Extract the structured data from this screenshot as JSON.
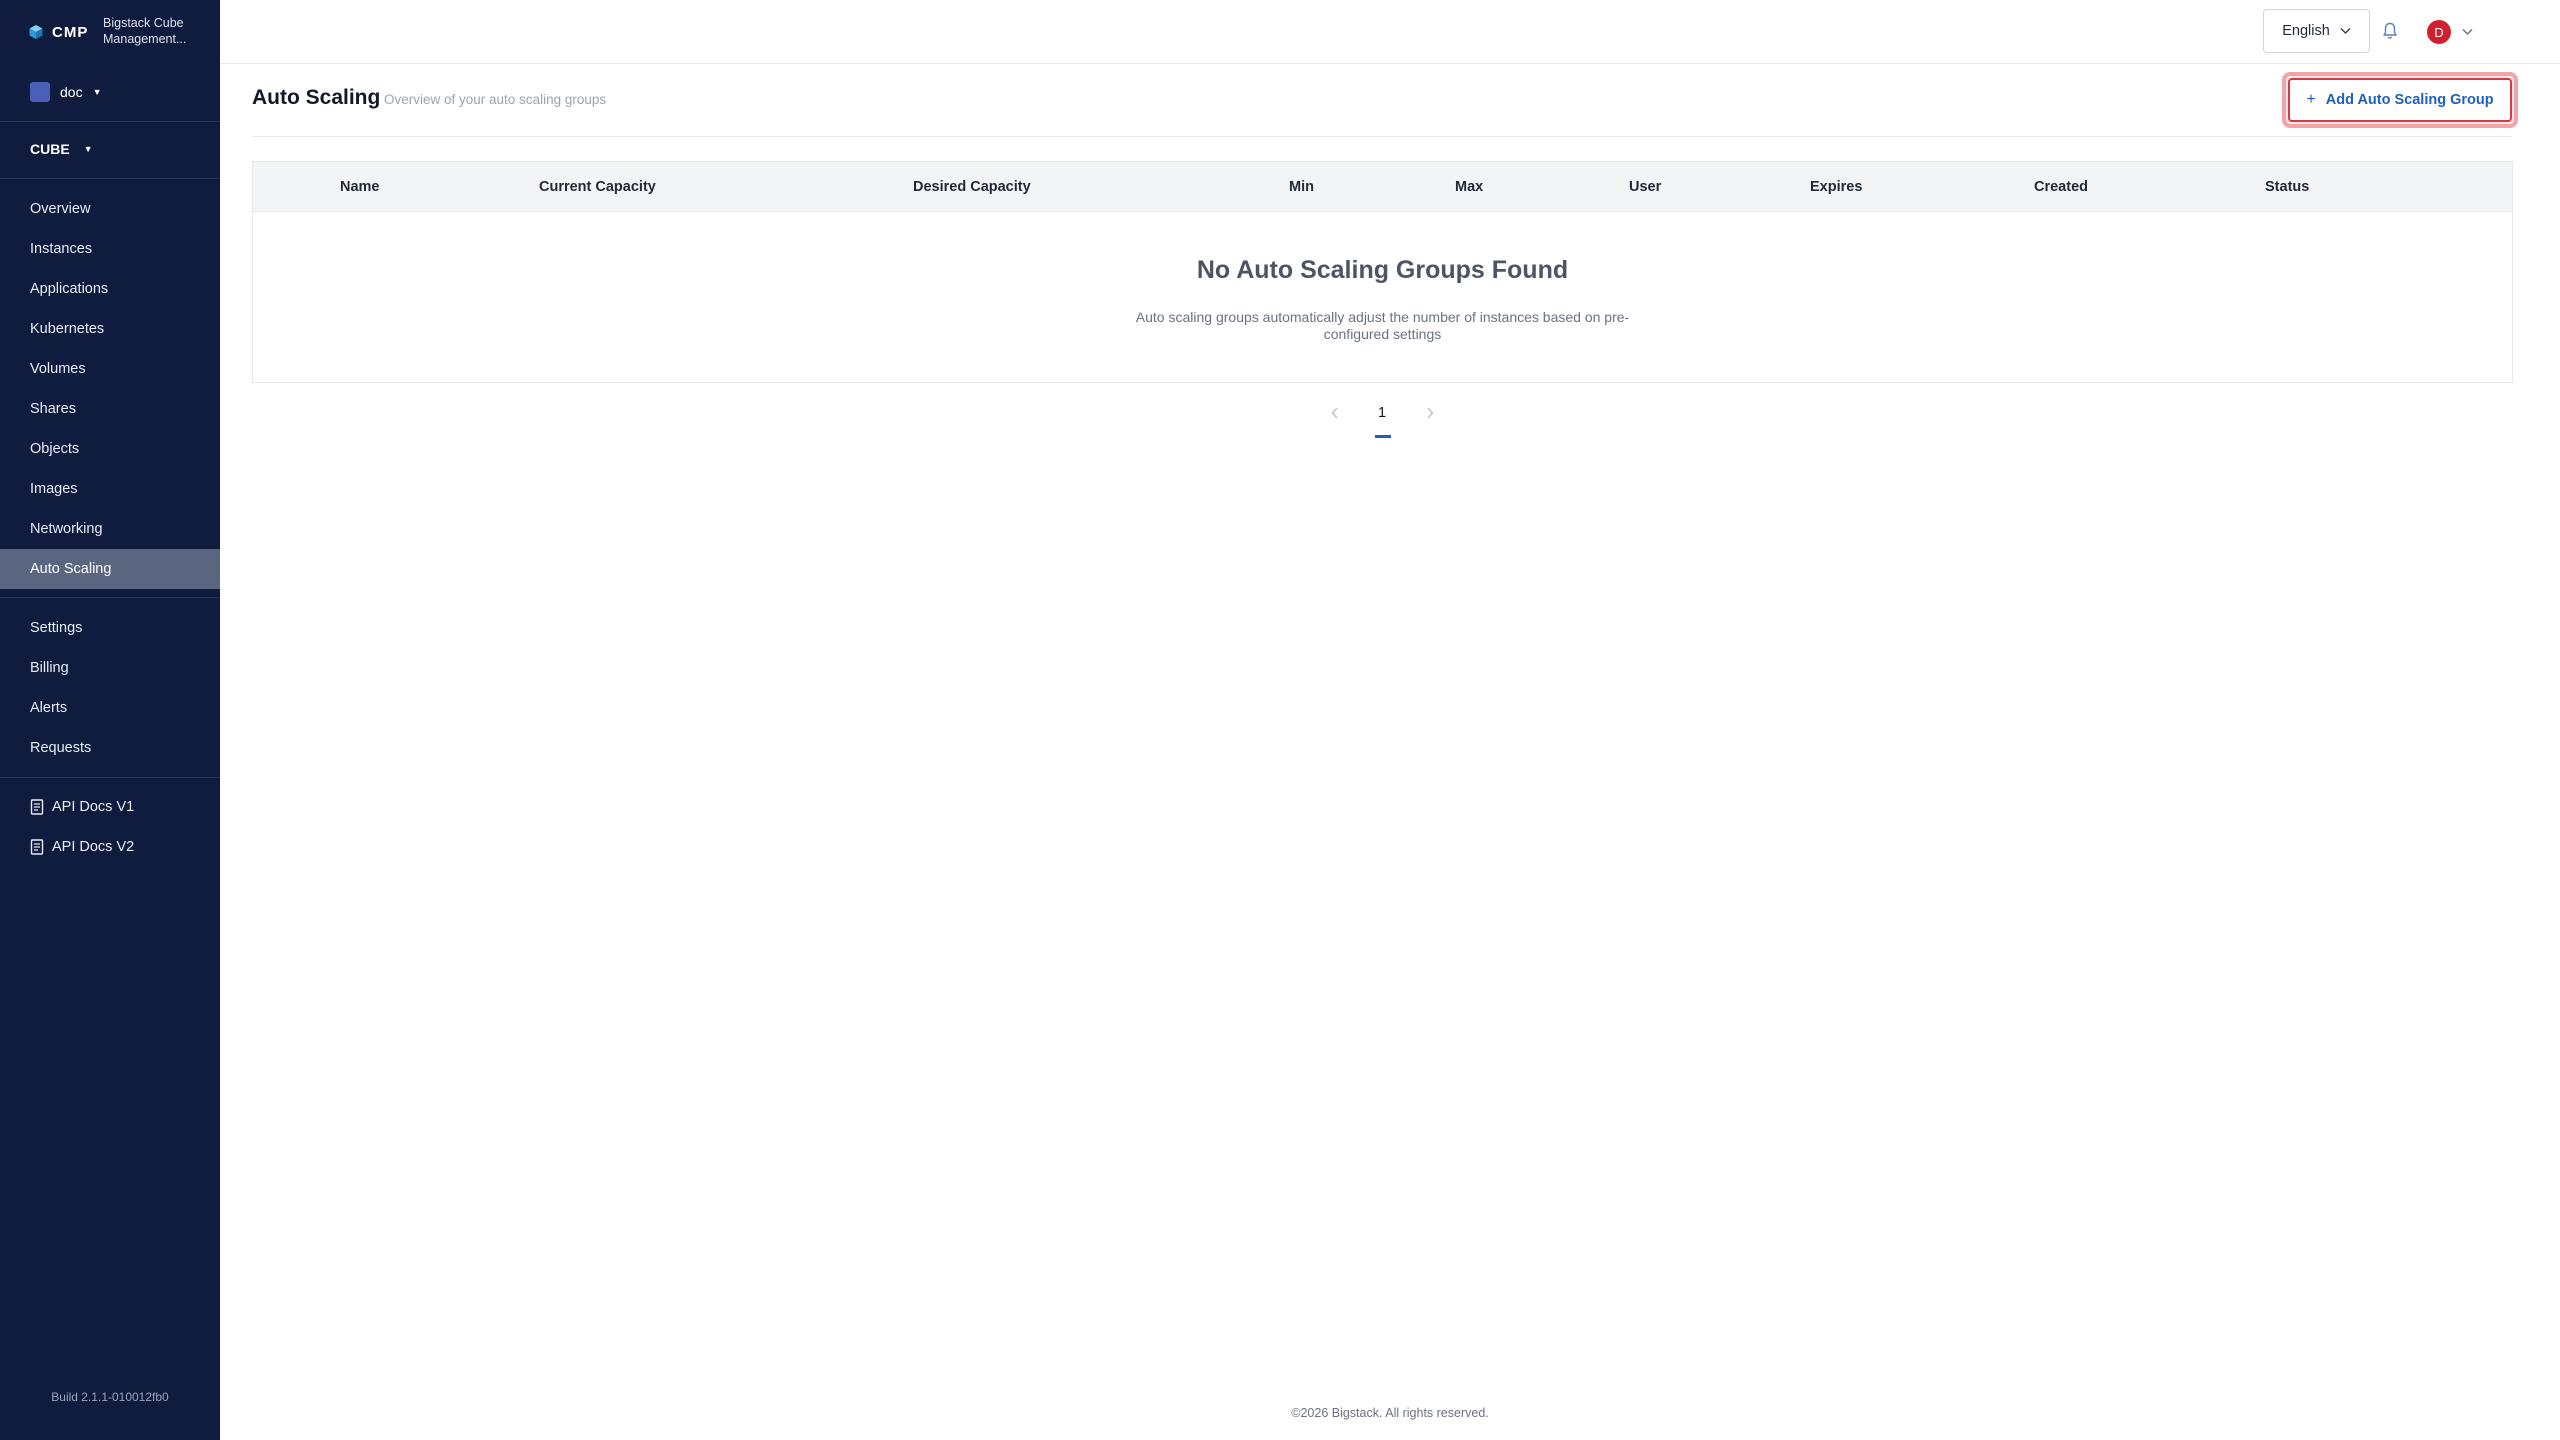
{
  "brand": {
    "logo_text": "CMP",
    "name": "Bigstack Cube Management..."
  },
  "project": {
    "name": "doc"
  },
  "cluster": {
    "name": "CUBE"
  },
  "sidebar": {
    "main_items": [
      {
        "label": "Overview"
      },
      {
        "label": "Instances"
      },
      {
        "label": "Applications"
      },
      {
        "label": "Kubernetes"
      },
      {
        "label": "Volumes"
      },
      {
        "label": "Shares"
      },
      {
        "label": "Objects"
      },
      {
        "label": "Images"
      },
      {
        "label": "Networking"
      },
      {
        "label": "Auto Scaling",
        "active": true
      }
    ],
    "secondary_items": [
      {
        "label": "Settings"
      },
      {
        "label": "Billing"
      },
      {
        "label": "Alerts"
      },
      {
        "label": "Requests"
      }
    ],
    "doc_items": [
      {
        "label": "API Docs V1"
      },
      {
        "label": "API Docs V2"
      }
    ],
    "build": "Build 2.1.1-010012fb0"
  },
  "topbar": {
    "language": "English",
    "avatar_initial": "D"
  },
  "page": {
    "title": "Auto Scaling",
    "subtitle": "Overview of your auto scaling groups",
    "add_button": "Add Auto Scaling Group"
  },
  "table": {
    "columns": [
      "Name",
      "Current Capacity",
      "Desired Capacity",
      "Min",
      "Max",
      "User",
      "Expires",
      "Created",
      "Status"
    ],
    "empty_title": "No Auto Scaling Groups Found",
    "empty_description": "Auto scaling groups automatically adjust the number of instances based on pre-configured settings"
  },
  "pagination": {
    "current_page": "1"
  },
  "footer": {
    "copyright": "©2026 Bigstack. All rights reserved."
  },
  "colors": {
    "sidebar_bg": "#101c3d",
    "active_item_bg": "#5a6580",
    "accent_blue": "#1f5fbf",
    "highlight_red": "#d63a44",
    "avatar_red": "#d0202e"
  }
}
